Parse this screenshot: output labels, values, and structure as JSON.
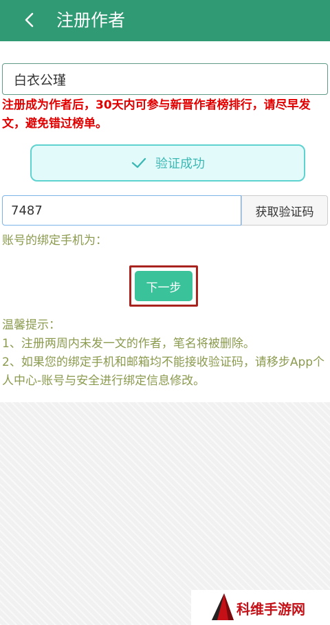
{
  "header": {
    "title": "注册作者"
  },
  "form": {
    "pen_name_value": "白衣公瑾",
    "notice": "注册成为作者后，30天内可参与新晋作者榜排行，请尽早发文，避免错过榜单。",
    "verify_status": "验证成功",
    "code_value": "7487",
    "get_code_label": "获取验证码",
    "phone_label": "账号的绑定手机为：",
    "next_label": "下一步"
  },
  "tips": {
    "title": "温馨提示：",
    "items": [
      "1、注册两周内未发一文的作者，笔名将被删除。",
      "2、如果您的绑定手机和邮箱均不能接收验证码，请移步App个人中心-账号与安全进行绑定信息修改。"
    ]
  },
  "watermark": {
    "text": "科维手游网"
  },
  "colors": {
    "header_bg": "#2f9a74",
    "notice_red": "#e00000",
    "success_teal": "#3cb8b4",
    "next_button_green": "#3ac29a",
    "highlight_frame": "#a8221e",
    "tip_text": "#8a9a4e"
  },
  "icons": {
    "back": "chevron-left-icon",
    "verify": "check-icon",
    "logo": "pyramid-logo"
  }
}
